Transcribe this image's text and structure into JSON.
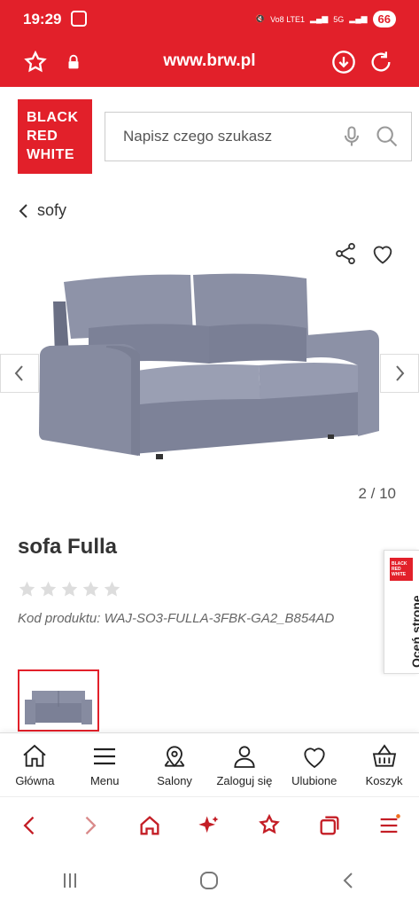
{
  "status": {
    "time": "19:29",
    "battery": "66",
    "net1": "Vo8 LTE1",
    "net2": "5G"
  },
  "browser": {
    "url": "www.brw.pl"
  },
  "logo": {
    "line1": "BLACK",
    "line2": "RED",
    "line3": "WHITE"
  },
  "search": {
    "placeholder": "Napisz czego szukasz"
  },
  "breadcrumb": {
    "label": "sofy"
  },
  "gallery": {
    "counter": "2 / 10"
  },
  "product": {
    "title": "sofa Fulla",
    "rating_stars": 0,
    "code": "Kod produktu: WAJ-SO3-FULLA-3FBK-GA2_B854AD"
  },
  "rate_tab": {
    "label": "Oceń stronę",
    "logo_text": "BLACK RED WHITE"
  },
  "bottom_nav": [
    {
      "label": "Główna",
      "icon": "home-icon"
    },
    {
      "label": "Menu",
      "icon": "menu-icon"
    },
    {
      "label": "Salony",
      "icon": "location-pin-icon"
    },
    {
      "label": "Zaloguj się",
      "icon": "user-icon"
    },
    {
      "label": "Ulubione",
      "icon": "heart-icon"
    },
    {
      "label": "Koszyk",
      "icon": "basket-icon"
    }
  ],
  "colors": {
    "brand": "#e2202a",
    "browser_accent": "#c41e26"
  }
}
